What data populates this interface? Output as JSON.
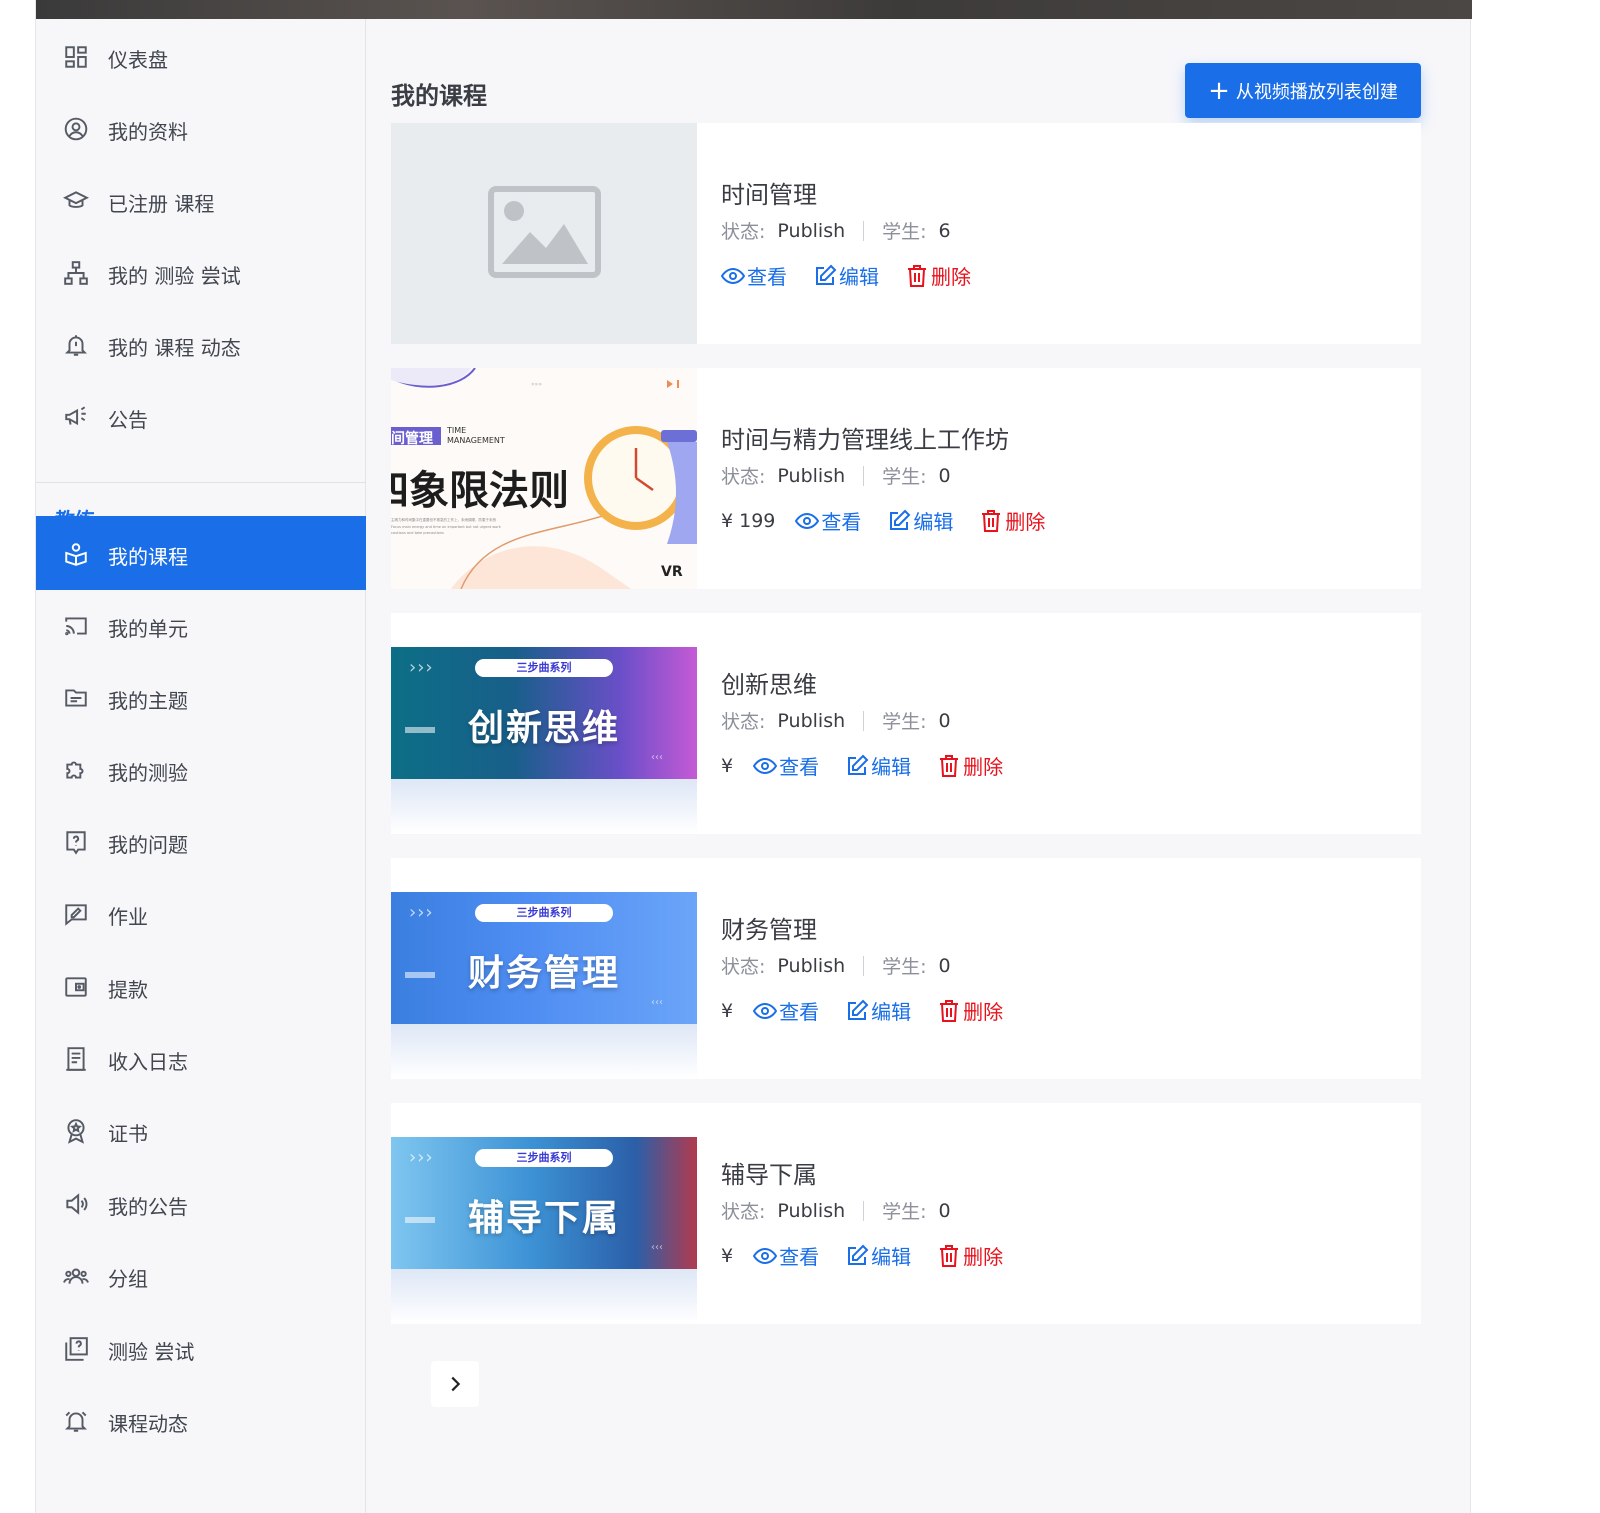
{
  "sidebar": {
    "items": [
      {
        "label": "仪表盘",
        "icon": "dashboard-icon"
      },
      {
        "label": "我的资料",
        "icon": "user-circle-icon"
      },
      {
        "label": "已注册 课程",
        "icon": "graduation-cap-icon"
      },
      {
        "label": "我的 测验 尝试",
        "icon": "sitemap-icon"
      },
      {
        "label": "我的 课程 动态",
        "icon": "bell-icon"
      },
      {
        "label": "公告",
        "icon": "megaphone-icon"
      }
    ],
    "section_title": "教练",
    "instructor_items": [
      {
        "label": "我的课程",
        "icon": "book-user-icon",
        "active": true
      },
      {
        "label": "我的单元",
        "icon": "cast-icon"
      },
      {
        "label": "我的主题",
        "icon": "folder-icon"
      },
      {
        "label": "我的测验",
        "icon": "puzzle-icon"
      },
      {
        "label": "我的问题",
        "icon": "question-icon"
      },
      {
        "label": "作业",
        "icon": "assignment-icon"
      },
      {
        "label": "提款",
        "icon": "wallet-icon"
      },
      {
        "label": "收入日志",
        "icon": "receipt-icon"
      },
      {
        "label": "证书",
        "icon": "award-icon"
      },
      {
        "label": "我的公告",
        "icon": "speaker-icon"
      },
      {
        "label": "分组",
        "icon": "group-icon"
      },
      {
        "label": "测验 尝试",
        "icon": "quiz-attempt-icon"
      },
      {
        "label": "课程动态",
        "icon": "alarm-bell-icon"
      }
    ]
  },
  "main": {
    "title": "我的课程",
    "create_button": {
      "plus": "+",
      "label": "从视频播放列表创建"
    },
    "labels": {
      "status": "状态:",
      "students": "学生:",
      "view": "查看",
      "edit": "编辑",
      "delete": "删除"
    },
    "courses": [
      {
        "title": "时间管理",
        "status": "Publish",
        "students": "6",
        "price": "",
        "thumb": "placeholder"
      },
      {
        "title": "时间与精力管理线上工作坊",
        "status": "Publish",
        "students": "0",
        "price": "¥ 199",
        "thumb": "time-quadrant",
        "thumb_text": {
          "tag": "间管理",
          "sub": "TIME MANAGEMENT",
          "big": "四象限法则",
          "logo": "VR"
        }
      },
      {
        "title": "创新思维",
        "status": "Publish",
        "students": "0",
        "price": "¥",
        "thumb": "banner",
        "thumb_text": {
          "pill": "三步曲系列",
          "big": "创新思维"
        }
      },
      {
        "title": "财务管理",
        "status": "Publish",
        "students": "0",
        "price": "¥",
        "thumb": "banner",
        "thumb_text": {
          "pill": "三步曲系列",
          "big": "财务管理"
        }
      },
      {
        "title": "辅导下属",
        "status": "Publish",
        "students": "0",
        "price": "¥",
        "thumb": "banner",
        "thumb_text": {
          "pill": "三步曲系列",
          "big": "辅导下属"
        }
      }
    ]
  },
  "colors": {
    "accent": "#1a6ee8",
    "danger": "#e8121c",
    "sidebar_bg": "#f7f7fa"
  },
  "pager": {
    "icon": "chevron-right-icon"
  }
}
